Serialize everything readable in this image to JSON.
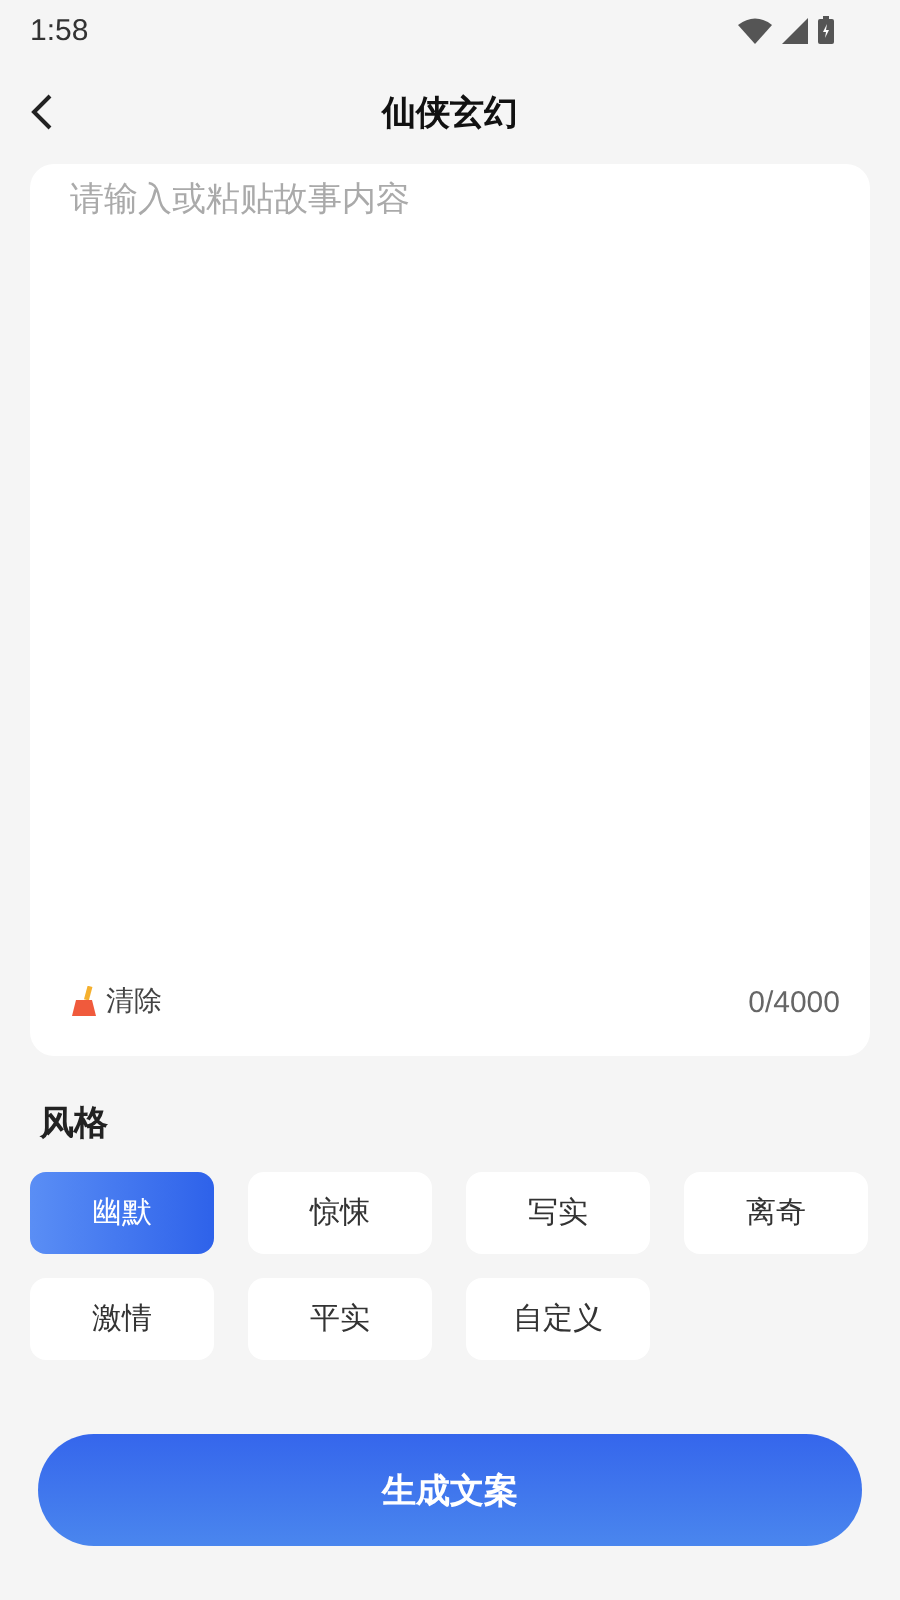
{
  "status_bar": {
    "time": "1:58"
  },
  "header": {
    "title": "仙侠玄幻"
  },
  "story_input": {
    "placeholder": "请输入或粘贴故事内容",
    "clear_label": "清除",
    "counter": "0/4000"
  },
  "style_section": {
    "title": "风格",
    "options": [
      {
        "label": "幽默",
        "selected": true
      },
      {
        "label": "惊悚",
        "selected": false
      },
      {
        "label": "写实",
        "selected": false
      },
      {
        "label": "离奇",
        "selected": false
      },
      {
        "label": "激情",
        "selected": false
      },
      {
        "label": "平实",
        "selected": false
      },
      {
        "label": "自定义",
        "selected": false
      }
    ]
  },
  "generate_button": {
    "label": "生成文案"
  }
}
